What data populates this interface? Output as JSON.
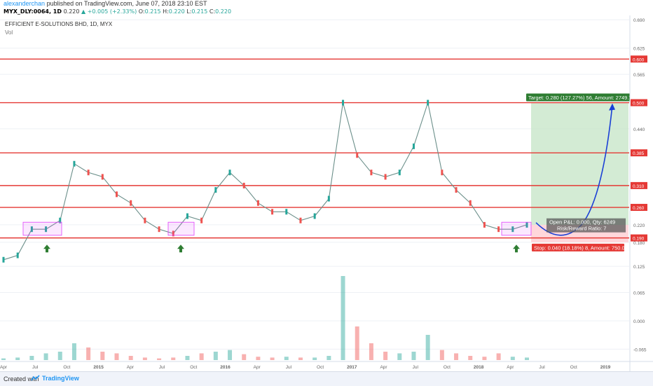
{
  "header": {
    "author": "alexanderchan",
    "published": "published on TradingView.com, June 07, 2018 23:10 EST",
    "symbol": "MYX_DLY:0064, 1D",
    "price": "0.220",
    "change": "▲ +0.005 (+2.33%)",
    "o_label": "O:",
    "o_val": "0.215",
    "h_label": "H:",
    "h_val": "0.220",
    "l_label": "L:",
    "l_val": "0.215",
    "c_label": "C:",
    "c_val": "0.220"
  },
  "chart_title": "EFFICIENT E-SOLUTIONS BHD, 1D, MYX",
  "vol_label": "Vol",
  "colors": {
    "resistance": "#e53935",
    "candle_up": "#26a69a",
    "candle_down": "#ef5350",
    "target_zone": "#c8e6c9",
    "stop_zone": "#ffcdd2",
    "arrow": "#2e7d32",
    "curve": "#1a3fd6",
    "box": "#e040fb"
  },
  "chart_data": {
    "type": "line",
    "title": "EFFICIENT E-SOLUTIONS BHD, 1D, MYX",
    "x": [
      "2014-04",
      "2014-06",
      "2014-07",
      "2014-08",
      "2014-09",
      "2014-10",
      "2014-11",
      "2014-12",
      "2015-01",
      "2015-03",
      "2015-05",
      "2015-06",
      "2015-08",
      "2015-09",
      "2015-10",
      "2015-12",
      "2016-01",
      "2016-03",
      "2016-05",
      "2016-07",
      "2016-09",
      "2016-11",
      "2017-01",
      "2017-02",
      "2017-03",
      "2017-04",
      "2017-05",
      "2017-07",
      "2017-09",
      "2017-10",
      "2017-11",
      "2017-12",
      "2018-01",
      "2018-02",
      "2018-03",
      "2018-04",
      "2018-05",
      "2018-06"
    ],
    "series": [
      {
        "values": [
          0.14,
          0.15,
          0.21,
          0.21,
          0.23,
          0.36,
          0.34,
          0.33,
          0.29,
          0.27,
          0.23,
          0.21,
          0.2,
          0.24,
          0.23,
          0.3,
          0.34,
          0.31,
          0.27,
          0.25,
          0.25,
          0.23,
          0.24,
          0.28,
          0.5,
          0.38,
          0.34,
          0.33,
          0.34,
          0.4,
          0.5,
          0.34,
          0.3,
          0.27,
          0.22,
          0.21,
          0.21,
          0.22
        ]
      }
    ],
    "volume": [
      0.02,
      0.03,
      0.05,
      0.08,
      0.1,
      0.2,
      0.15,
      0.1,
      0.08,
      0.05,
      0.03,
      0.02,
      0.03,
      0.05,
      0.08,
      0.1,
      0.12,
      0.07,
      0.04,
      0.03,
      0.04,
      0.03,
      0.03,
      0.05,
      1.0,
      0.4,
      0.2,
      0.1,
      0.08,
      0.1,
      0.3,
      0.12,
      0.08,
      0.05,
      0.04,
      0.08,
      0.04,
      0.03
    ],
    "resistance_levels": [
      {
        "value": 0.6,
        "label": "0.600"
      },
      {
        "value": 0.5,
        "label": "0.500"
      },
      {
        "value": 0.385,
        "label": "0.385"
      },
      {
        "value": 0.31,
        "label": "0.310"
      },
      {
        "value": 0.26,
        "label": "0.260"
      },
      {
        "value": 0.19,
        "label": "0.190"
      }
    ],
    "price_axis_ticks": [
      "0.690",
      "0.625",
      "0.565",
      "0.440",
      "0.220",
      "0.180",
      "0.125",
      "0.065",
      "0.000",
      "-0.065"
    ],
    "time_axis_ticks": [
      "Apr",
      "Jul",
      "Oct",
      "2015",
      "Apr",
      "Jul",
      "Oct",
      "2016",
      "Apr",
      "Jul",
      "Oct",
      "2017",
      "Apr",
      "Jul",
      "Oct",
      "2018",
      "Apr",
      "Jul",
      "Oct",
      "2019"
    ],
    "position": {
      "entry": 0.22,
      "target": 0.5,
      "stop": 0.18,
      "target_label": "Target: 0.280 (127.27%) 56, Amount: 2749.72",
      "stop_label": "Stop: 0.040 (18.18%) 8, Amount: 750.04",
      "open_pl_label": "Open P&L: 0.000, Qty: 6249",
      "risk_reward_label": "Risk/Reward Ratio: 7"
    },
    "ylim": [
      -0.09,
      0.7
    ]
  },
  "footer": {
    "created_with": "Created with",
    "brand": "TradingView"
  }
}
